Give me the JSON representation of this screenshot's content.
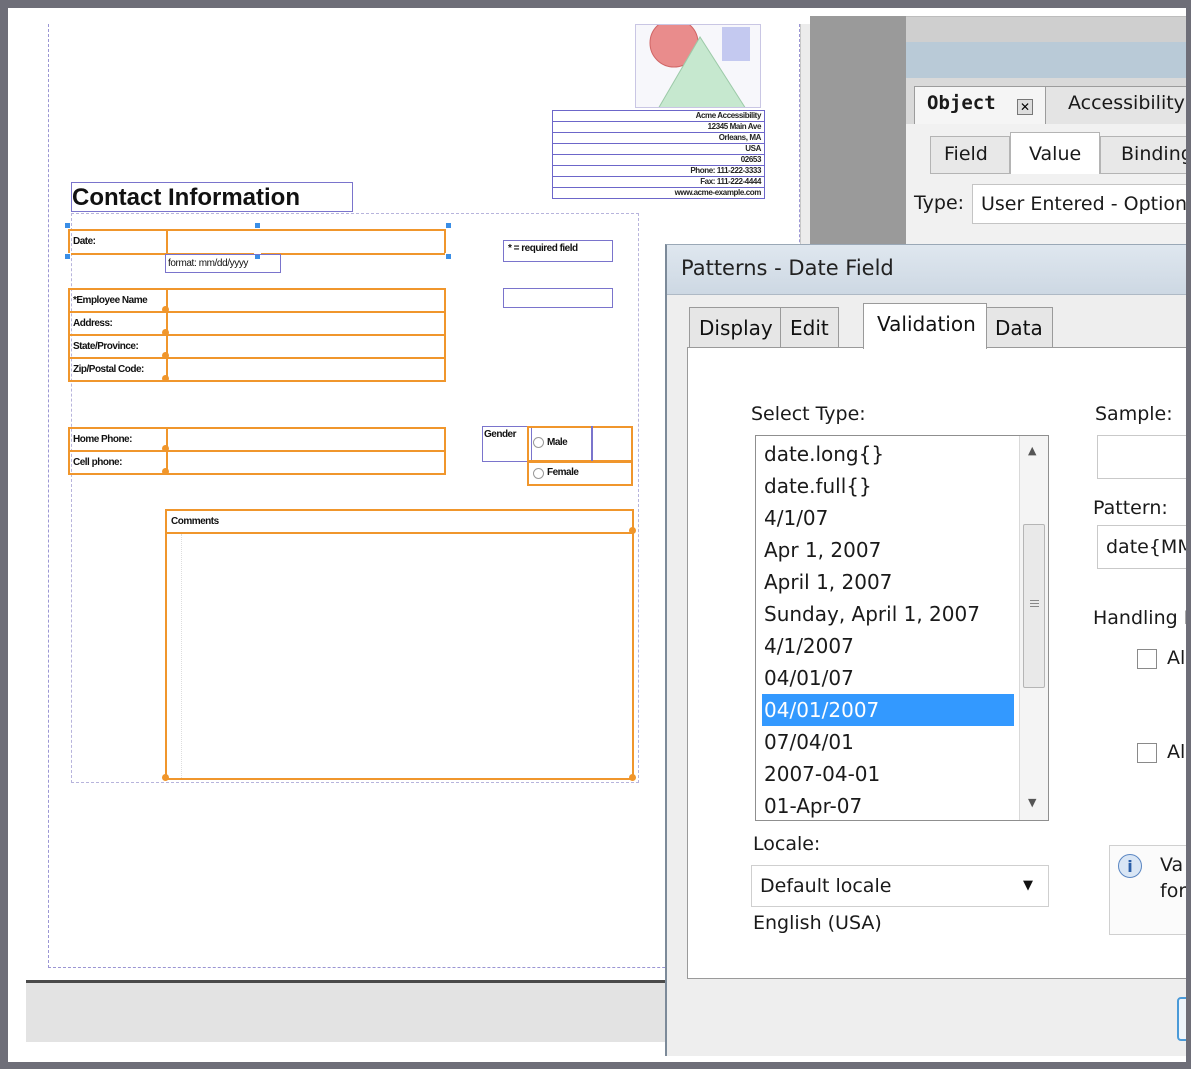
{
  "form": {
    "section_title": "Contact Information",
    "address_lines": [
      "Acme Accessibility",
      "12345 Main Ave",
      "Orleans, MA",
      "USA",
      "02653",
      "Phone: 111-222-3333",
      "Fax: 111-222-4444",
      "www.acme-example.com"
    ],
    "date_label": "Date:",
    "date_format_hint": "format: mm/dd/yyyy",
    "required_note": "* = required field",
    "employee_name_label": "*Employee Name",
    "address_label": "Address:",
    "state_label": "State/Province:",
    "zip_label": "Zip/Postal Code:",
    "home_phone_label": "Home Phone:",
    "cell_phone_label": "Cell phone:",
    "gender_label": "Gender",
    "male_label": "Male",
    "female_label": "Female",
    "comments_label": "Comments"
  },
  "object_panel": {
    "tabs": [
      "Object",
      "Accessibility"
    ],
    "subtabs": [
      "Field",
      "Value",
      "Binding"
    ],
    "type_label": "Type:",
    "type_value": "User Entered - Optional"
  },
  "dialog": {
    "title": "Patterns - Date Field",
    "tabs": [
      "Display",
      "Edit",
      "Validation",
      "Data"
    ],
    "active_tab": "Validation",
    "select_type_label": "Select Type:",
    "types": [
      "date.long{}",
      "date.full{}",
      "4/1/07",
      "Apr 1, 2007",
      "April 1, 2007",
      "Sunday, April 1, 2007",
      "4/1/2007",
      "04/01/07",
      "04/01/2007",
      "07/04/01",
      "2007-04-01",
      "01-Apr-07"
    ],
    "selected_type": "04/01/2007",
    "locale_label": "Locale:",
    "locale_value": "Default locale",
    "locale_detail": "English (USA)",
    "sample_label": "Sample:",
    "pattern_label": "Pattern:",
    "pattern_value": "date{MM/DD/YYYY}",
    "handling_label": "Handling Empty Input",
    "allow_label_1": "Allow empty",
    "allow_label_2": "Allow any",
    "info_text_1": "Va",
    "info_text_2": "for"
  }
}
